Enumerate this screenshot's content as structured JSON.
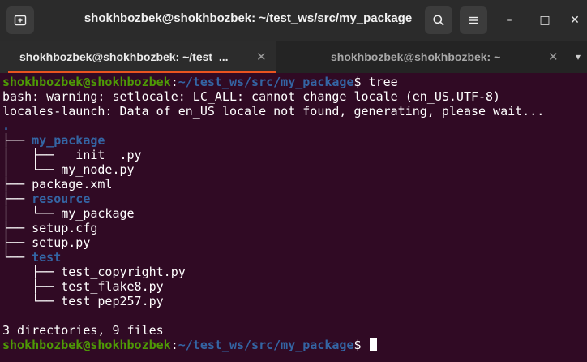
{
  "window": {
    "title": "shokhbozbek@shokhbozbek: ~/test_ws/src/my_package",
    "new_tab_icon": "new-tab-icon",
    "search_icon": "search-icon",
    "menu_icon": "hamburger-menu-icon",
    "minimize_glyph": "–",
    "maximize_glyph": "□",
    "close_glyph": "✕"
  },
  "tabs": [
    {
      "label": "shokhbozbek@shokhbozbek: ~/test_...",
      "close": "✕",
      "active": true
    },
    {
      "label": "shokhbozbek@shokhbozbek: ~",
      "close": "✕",
      "active": false
    }
  ],
  "tabs_menu_glyph": "▾",
  "terminal": {
    "prompt_user": "shokhbozbek@shokhbozbek",
    "prompt_sep": ":",
    "prompt_path": "~/test_ws/src/my_package",
    "prompt_end": "$ ",
    "command": "tree",
    "warning": "bash: warning: setlocale: LC_ALL: cannot change locale (en_US.UTF-8)",
    "locales": "locales-launch: Data of en_US locale not found, generating, please wait...",
    "tree_root": ".",
    "tree": [
      {
        "prefix": "├── ",
        "name": "my_package",
        "type": "dir"
      },
      {
        "prefix": "│   ├── ",
        "name": "__init__.py",
        "type": "file"
      },
      {
        "prefix": "│   └── ",
        "name": "my_node.py",
        "type": "file"
      },
      {
        "prefix": "├── ",
        "name": "package.xml",
        "type": "file"
      },
      {
        "prefix": "├── ",
        "name": "resource",
        "type": "dir"
      },
      {
        "prefix": "│   └── ",
        "name": "my_package",
        "type": "file"
      },
      {
        "prefix": "├── ",
        "name": "setup.cfg",
        "type": "file"
      },
      {
        "prefix": "├── ",
        "name": "setup.py",
        "type": "file"
      },
      {
        "prefix": "└── ",
        "name": "test",
        "type": "dir"
      },
      {
        "prefix": "    ├── ",
        "name": "test_copyright.py",
        "type": "file"
      },
      {
        "prefix": "    ├── ",
        "name": "test_flake8.py",
        "type": "file"
      },
      {
        "prefix": "    └── ",
        "name": "test_pep257.py",
        "type": "file"
      }
    ],
    "summary": "3 directories, 9 files"
  },
  "colors": {
    "background": "#300a24",
    "prompt_user": "#4e9a06",
    "prompt_path": "#3465a4",
    "directory": "#3465a4",
    "tab_accent": "#e95420"
  }
}
